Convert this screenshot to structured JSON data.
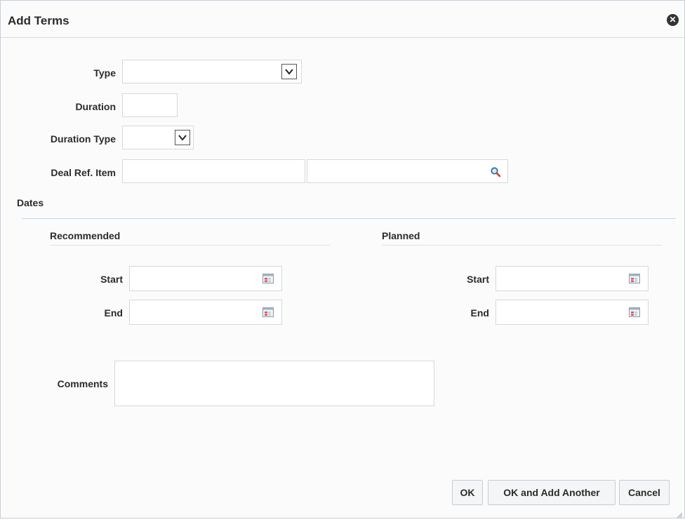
{
  "dialog": {
    "title": "Add Terms"
  },
  "form": {
    "type_label": "Type",
    "type_value": "",
    "duration_label": "Duration",
    "duration_value": "",
    "duration_type_label": "Duration Type",
    "duration_type_value": "",
    "deal_ref_item_label": "Deal Ref. Item",
    "deal_ref_item_value": "",
    "deal_ref_item_desc": ""
  },
  "dates": {
    "section_label": "Dates",
    "recommended": {
      "heading": "Recommended",
      "start_label": "Start",
      "end_label": "End",
      "start_value": "",
      "end_value": ""
    },
    "planned": {
      "heading": "Planned",
      "start_label": "Start",
      "end_label": "End",
      "start_value": "",
      "end_value": ""
    }
  },
  "comments": {
    "label": "Comments",
    "value": ""
  },
  "buttons": {
    "ok": "OK",
    "ok_add_another": "OK and Add Another",
    "cancel": "Cancel"
  },
  "icons": {
    "close": "close-icon",
    "dropdown": "chevron-down-icon",
    "search": "search-icon",
    "calendar": "calendar-icon"
  },
  "colors": {
    "accent": "#1a6fb3",
    "calendar_red": "#d9534f",
    "search_blue": "#2f6fa8"
  }
}
